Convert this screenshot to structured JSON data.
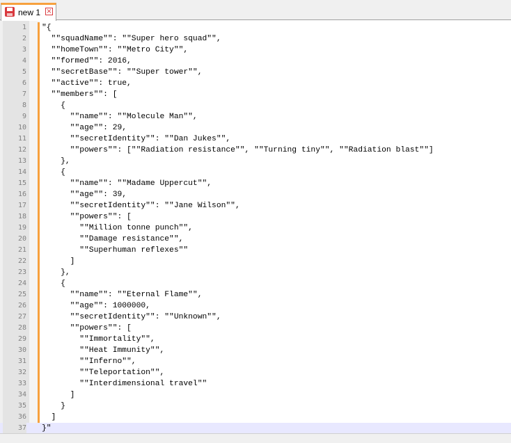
{
  "tabs": [
    {
      "label": "new 1",
      "icon": "save-icon",
      "close_icon": "close-icon",
      "close_glyph": "×"
    }
  ],
  "editor": {
    "current_line": 37,
    "lines": [
      "\"{",
      "  \"\"squadName\"\": \"\"Super hero squad\"\",",
      "  \"\"homeTown\"\": \"\"Metro City\"\",",
      "  \"\"formed\"\": 2016,",
      "  \"\"secretBase\"\": \"\"Super tower\"\",",
      "  \"\"active\"\": true,",
      "  \"\"members\"\": [",
      "    {",
      "      \"\"name\"\": \"\"Molecule Man\"\",",
      "      \"\"age\"\": 29,",
      "      \"\"secretIdentity\"\": \"\"Dan Jukes\"\",",
      "      \"\"powers\"\": [\"\"Radiation resistance\"\", \"\"Turning tiny\"\", \"\"Radiation blast\"\"]",
      "    },",
      "    {",
      "      \"\"name\"\": \"\"Madame Uppercut\"\",",
      "      \"\"age\"\": 39,",
      "      \"\"secretIdentity\"\": \"\"Jane Wilson\"\",",
      "      \"\"powers\"\": [",
      "        \"\"Million tonne punch\"\",",
      "        \"\"Damage resistance\"\",",
      "        \"\"Superhuman reflexes\"\"",
      "      ]",
      "    },",
      "    {",
      "      \"\"name\"\": \"\"Eternal Flame\"\",",
      "      \"\"age\"\": 1000000,",
      "      \"\"secretIdentity\"\": \"\"Unknown\"\",",
      "      \"\"powers\"\": [",
      "        \"\"Immortality\"\",",
      "        \"\"Heat Immunity\"\",",
      "        \"\"Inferno\"\",",
      "        \"\"Teleportation\"\",",
      "        \"\"Interdimensional travel\"\"",
      "      ]",
      "    }",
      "  ]",
      "}\""
    ]
  },
  "colors": {
    "tab_accent": "#f7a13e",
    "icon_red": "#d9393e",
    "current_line_bg": "#e8e8ff",
    "gutter_bg": "#e4e4e4",
    "line_number": "#808080"
  }
}
